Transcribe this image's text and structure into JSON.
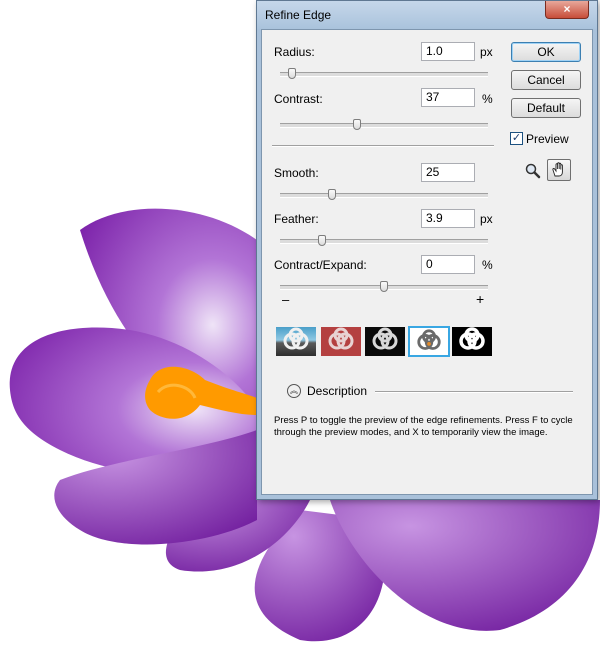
{
  "dialog": {
    "title": "Refine Edge",
    "close_glyph": "×",
    "radius": {
      "label": "Radius:",
      "value": "1.0",
      "unit": "px",
      "slider_fraction": 0.04
    },
    "contrast": {
      "label": "Contrast:",
      "value": "37",
      "unit": "%",
      "slider_fraction": 0.37
    },
    "smooth": {
      "label": "Smooth:",
      "value": "25",
      "slider_fraction": 0.25
    },
    "feather": {
      "label": "Feather:",
      "value": "3.9",
      "unit": "px",
      "slider_fraction": 0.2
    },
    "contract": {
      "label": "Contract/Expand:",
      "value": "0",
      "unit": "%",
      "slider_fraction": 0.5,
      "minus_glyph": "–",
      "plus_glyph": "+"
    },
    "buttons": {
      "ok": "OK",
      "cancel": "Cancel",
      "default": "Default"
    },
    "preview": {
      "label": "Preview",
      "checked": true,
      "check_glyph": "✓"
    },
    "tools": [
      "zoom-icon",
      "hand-icon"
    ],
    "preview_modes": [
      "standard",
      "quick-mask",
      "on-black",
      "on-white",
      "mask"
    ],
    "selected_preview_mode": "on-white",
    "description": {
      "toggle_glyph": "︽",
      "header": "Description",
      "text": "Press P to toggle the preview of the edge refinements. Press F to cycle through the preview modes, and X to temporarily view the image."
    }
  },
  "colors": {
    "flower_purple": "#8a2fb5",
    "stamen_orange": "#ff9a00",
    "title_bar": "#aac3dc",
    "selection_border": "#39a7e3"
  }
}
